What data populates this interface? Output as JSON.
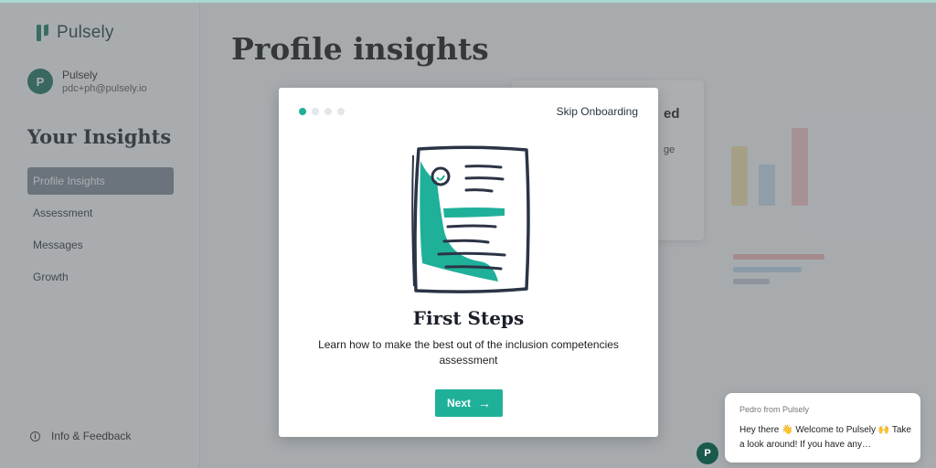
{
  "app": {
    "logo_text": "Pulsely",
    "logo_color": "#177a60"
  },
  "user": {
    "avatar_initial": "P",
    "name": "Pulsely",
    "email": "pdc+ph@pulsely.io"
  },
  "sidebar": {
    "heading": "Your Insights",
    "items": [
      {
        "label": "Profile Insights",
        "active": true
      },
      {
        "label": "Assessment",
        "active": false
      },
      {
        "label": "Messages",
        "active": false
      },
      {
        "label": "Growth",
        "active": false
      }
    ],
    "footer_link": "Info & Feedback",
    "footer_icon": "info-icon"
  },
  "main": {
    "page_title": "Profile insights",
    "background_card": {
      "title_fragment": "ed",
      "text_fragment": "ge"
    }
  },
  "modal": {
    "step": 1,
    "total_steps": 4,
    "skip_label": "Skip Onboarding",
    "illustration": "document-icon",
    "title": "First Steps",
    "description": "Learn how to make the best out of the inclusion competencies assessment",
    "next_label": "Next",
    "next_icon": "arrow-right-icon",
    "accent_color": "#1fb09a"
  },
  "chat": {
    "from": "Pedro from Pulsely",
    "message": "Hey there 👋 Welcome to Pulsely 🙌 Take a look around! If you have any…",
    "avatar_initial": "P"
  }
}
